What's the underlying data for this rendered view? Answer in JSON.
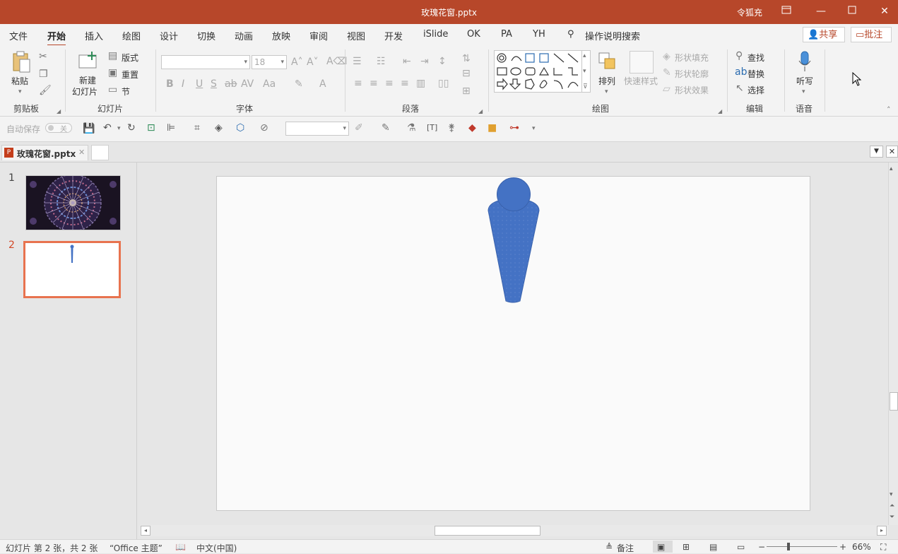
{
  "titlebar": {
    "title": "玫瑰花窗.pptx",
    "user": "令狐充"
  },
  "menu": {
    "tabs": [
      "文件",
      "开始",
      "插入",
      "绘图",
      "设计",
      "切换",
      "动画",
      "放映",
      "审阅",
      "视图",
      "开发",
      "iSlide",
      "OK",
      "PA",
      "YH"
    ],
    "active": "开始",
    "search": "操作说明搜索",
    "share": "共享",
    "comment": "批注"
  },
  "ribbon": {
    "clipboard": {
      "paste": "粘贴",
      "label": "剪贴板"
    },
    "slides": {
      "new_slide_1": "新建",
      "new_slide_2": "幻灯片",
      "layout": "版式",
      "reset": "重置",
      "section": "节",
      "label": "幻灯片"
    },
    "font": {
      "size": "18",
      "label": "字体"
    },
    "paragraph": {
      "label": "段落"
    },
    "drawing": {
      "arrange": "排列",
      "quick_styles": "快速样式",
      "shape_fill": "形状填充",
      "shape_outline": "形状轮廓",
      "shape_effects": "形状效果",
      "label": "绘图"
    },
    "editing": {
      "find": "查找",
      "replace": "替换",
      "select": "选择",
      "label": "编辑"
    },
    "voice": {
      "dictate": "听写",
      "label": "语音"
    }
  },
  "qat": {
    "autosave": "自动保存",
    "toggle_state": "关"
  },
  "doctab": {
    "name": "玫瑰花窗.pptx"
  },
  "thumbnails": [
    {
      "num": "1"
    },
    {
      "num": "2",
      "selected": true
    }
  ],
  "status": {
    "slide_info": "幻灯片 第 2 张，共 2 张",
    "theme": "“Office 主题”",
    "language": "中文(中国)",
    "notes": "备注",
    "zoom": "66%"
  },
  "colors": {
    "accent": "#b7472a",
    "shape_fill": "#4472c4",
    "thumb_border": "#e8734f"
  }
}
